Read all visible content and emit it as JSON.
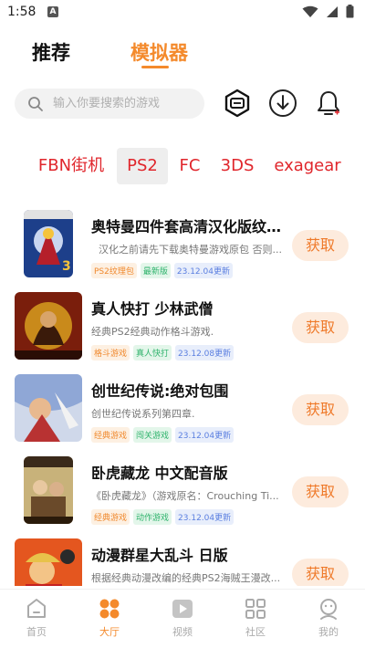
{
  "status": {
    "time": "1:58",
    "app_icon_letter": "A"
  },
  "tabs": {
    "recommend": "推荐",
    "emulator": "模拟器"
  },
  "search": {
    "placeholder": "输入你要搜索的游戏"
  },
  "icons": {
    "header": [
      "game-console-icon",
      "download-icon",
      "bell-icon"
    ],
    "nav": [
      "home-icon",
      "hall-icon",
      "video-icon",
      "community-icon",
      "mine-icon"
    ]
  },
  "platforms": [
    "FBN街机",
    "PS2",
    "FC",
    "3DS",
    "exagear"
  ],
  "games": [
    {
      "title": "奥特曼四件套高清汉化版纹...",
      "desc": "汉化之前请先下载奥特曼游戏原包 否则...",
      "tags": [
        "PS2纹理包",
        "最新版",
        "23.12.04更新"
      ],
      "action": "获取"
    },
    {
      "title": "真人快打 少林武僧",
      "desc": "经典PS2经典动作格斗游戏.",
      "tags": [
        "格斗游戏",
        "真人快打",
        "23.12.08更新"
      ],
      "action": "获取"
    },
    {
      "title": "创世纪传说:绝对包围",
      "desc": "创世纪传说系列第四章.",
      "tags": [
        "经典游戏",
        "闯关游戏",
        "23.12.04更新"
      ],
      "action": "获取"
    },
    {
      "title": "卧虎藏龙 中文配音版",
      "desc": "《卧虎藏龙》（游戏原名：Crouching Ti...",
      "tags": [
        "经典游戏",
        "动作游戏",
        "23.12.04更新"
      ],
      "action": "获取"
    },
    {
      "title": "动漫群星大乱斗 日版",
      "desc": "根据经典动漫改编的经典PS2海贼王漫改...",
      "tags": [],
      "action": "获取"
    }
  ],
  "nav": {
    "home": "首页",
    "hall": "大厅",
    "video": "视频",
    "community": "社区",
    "mine": "我的"
  },
  "colors": {
    "accent": "#f48a2c",
    "platform_text": "#e0262c",
    "get_button_bg": "#fdebdd"
  }
}
